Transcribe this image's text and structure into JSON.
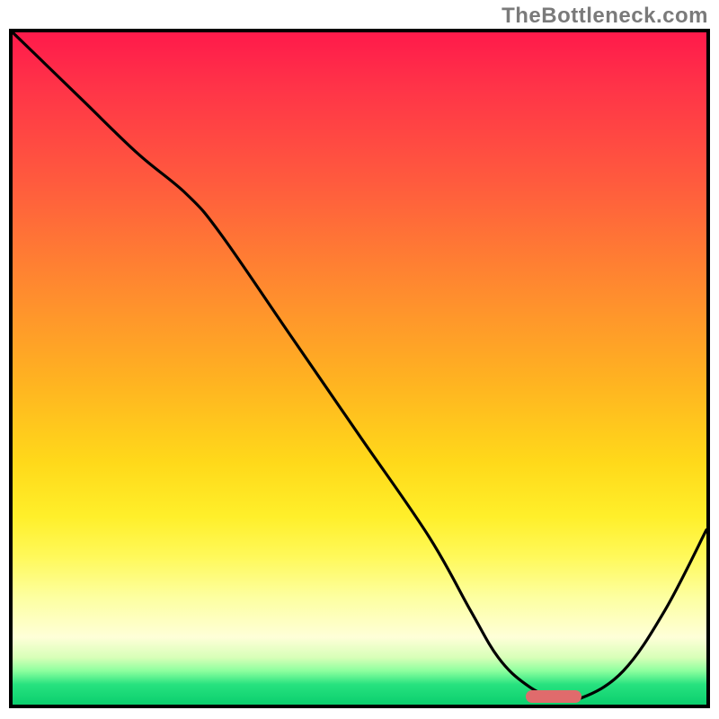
{
  "watermark": "TheBottleneck.com",
  "chart_data": {
    "type": "line",
    "title": "",
    "xlabel": "",
    "ylabel": "",
    "xlim": [
      0,
      100
    ],
    "ylim": [
      0,
      100
    ],
    "grid": false,
    "legend": false,
    "series": [
      {
        "name": "bottleneck-curve",
        "x": [
          0,
          4,
          10,
          18,
          25,
          30,
          40,
          50,
          60,
          66,
          70,
          74,
          78,
          82,
          88,
          94,
          100
        ],
        "values": [
          100,
          96,
          90,
          82,
          76,
          70,
          55,
          40,
          25,
          14,
          7,
          3,
          1,
          1,
          5,
          14,
          26
        ]
      }
    ],
    "marker": {
      "name": "optimal-range",
      "x_start": 74,
      "x_end": 82,
      "y": 1.2,
      "height_pct": 1.8,
      "color": "#e06b6c"
    },
    "gradient_stops": [
      {
        "pct": 0,
        "color": "#ff1a4b"
      },
      {
        "pct": 22,
        "color": "#ff5a3e"
      },
      {
        "pct": 52,
        "color": "#ffb321"
      },
      {
        "pct": 78,
        "color": "#fff95a"
      },
      {
        "pct": 90,
        "color": "#feffd8"
      },
      {
        "pct": 100,
        "color": "#0bcf6e"
      }
    ]
  }
}
